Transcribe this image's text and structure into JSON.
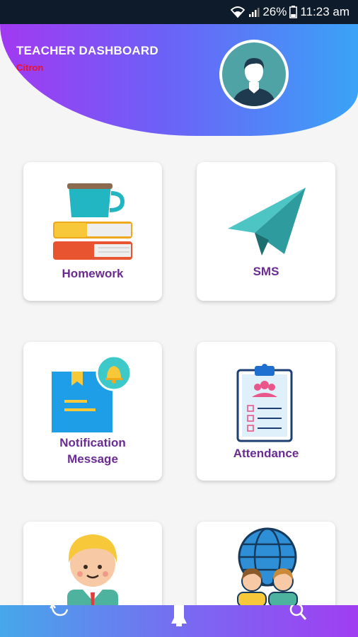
{
  "status_bar": {
    "battery": "26%",
    "time": "11:23 am",
    "icons": [
      "wifi-icon",
      "signal-icon",
      "battery-icon"
    ]
  },
  "header": {
    "title": "TEACHER DASHBOARD",
    "subtitle": "Citron",
    "avatar": "teacher-avatar-icon"
  },
  "tiles": [
    {
      "label": "Homework",
      "icon": "books-coffee-icon"
    },
    {
      "label": "SMS",
      "icon": "paper-plane-icon"
    },
    {
      "label_line1": "Notification",
      "label_line2": "Message",
      "icon": "notebook-bell-icon"
    },
    {
      "label": "Attendance",
      "icon": "clipboard-checklist-icon"
    },
    {
      "label": "",
      "icon": "student-icon"
    },
    {
      "label": "",
      "icon": "globe-people-icon"
    }
  ],
  "bottom_nav": {
    "items": [
      "history-icon",
      "bell-icon",
      "search-icon"
    ]
  },
  "colors": {
    "header_gradient_start": "#a239f2",
    "header_gradient_end": "#3aa3f7",
    "label_color": "#6a2c91",
    "subtitle_color": "#e8152b"
  }
}
